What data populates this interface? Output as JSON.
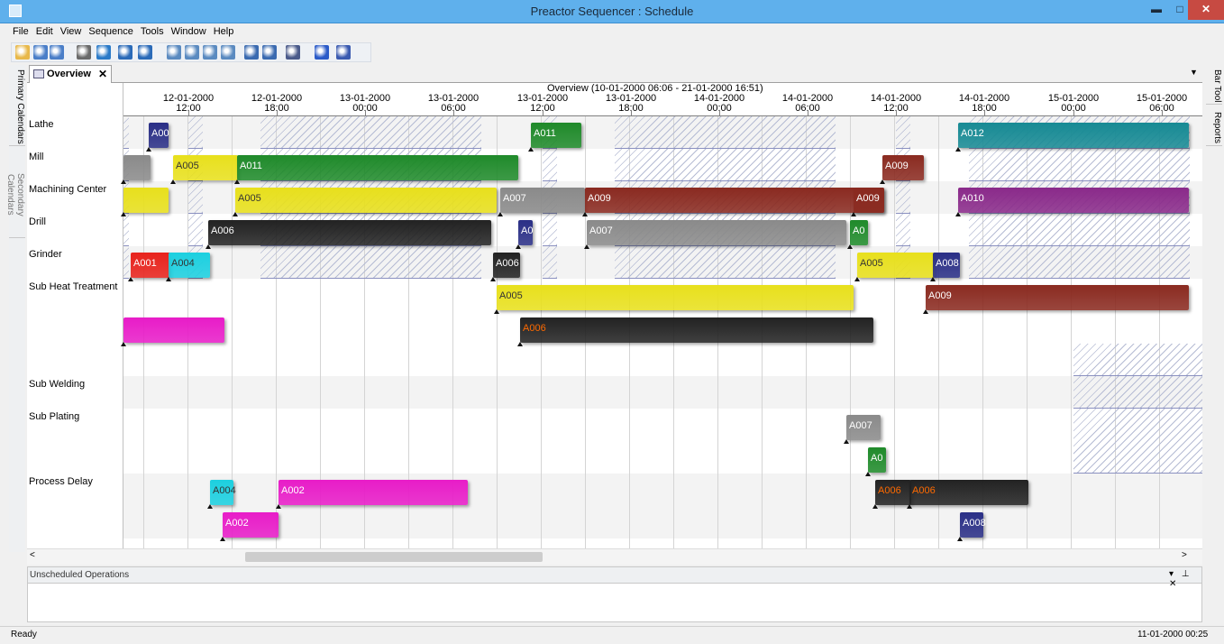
{
  "window": {
    "title": "Preactor Sequencer : Schedule",
    "minimize_glyph": "▬",
    "maximize_glyph": "□",
    "close_glyph": "✕"
  },
  "menu": [
    "File",
    "Edit",
    "View",
    "Sequence",
    "Tools",
    "Window",
    "Help"
  ],
  "toolbar_icons": [
    "open-icon",
    "save-icon",
    "save-all-icon",
    "print-icon",
    "check-icon",
    "undo-icon",
    "redo-icon",
    "view-icon",
    "grid-icon",
    "chart-icon",
    "table-icon",
    "export-icon",
    "import-icon",
    "find-icon",
    "help-icon",
    "document-icon"
  ],
  "side_tabs": {
    "left": [
      "Primary Calendars",
      "Secondary Calendars"
    ],
    "right": [
      "Bar Tool",
      "Reports"
    ]
  },
  "doc_tab": {
    "label": "Overview",
    "close": "✕"
  },
  "gantt": {
    "overview_label": "Overview    (10-01-2000 06:06 - 21-01-2000 16:51)",
    "ticks": [
      {
        "date": "12-01-2000",
        "time": "12:00"
      },
      {
        "date": "12-01-2000",
        "time": "18:00"
      },
      {
        "date": "13-01-2000",
        "time": "00:00"
      },
      {
        "date": "13-01-2000",
        "time": "06:00"
      },
      {
        "date": "13-01-2000",
        "time": "12:00"
      },
      {
        "date": "13-01-2000",
        "time": "18:00"
      },
      {
        "date": "14-01-2000",
        "time": "00:00"
      },
      {
        "date": "14-01-2000",
        "time": "06:00"
      },
      {
        "date": "14-01-2000",
        "time": "12:00"
      },
      {
        "date": "14-01-2000",
        "time": "18:00"
      },
      {
        "date": "15-01-2000",
        "time": "00:00"
      },
      {
        "date": "15-01-2000",
        "time": "06:00"
      }
    ],
    "resources": [
      "Lathe",
      "Mill",
      "Machining Center",
      "Drill",
      "Grinder",
      "Sub Heat Treatment",
      "Sub Welding",
      "Sub Plating",
      "Process Delay"
    ],
    "operations": [
      {
        "resource": "Lathe",
        "label": "A00",
        "color": "#2a2f86",
        "text_color": "#ffffff"
      },
      {
        "resource": "Lathe",
        "label": "A011",
        "color": "#1f8a2a",
        "text_color": "#ffffff"
      },
      {
        "resource": "Lathe",
        "label": "A012",
        "color": "#178a94",
        "text_color": "#ffffff"
      },
      {
        "resource": "Mill",
        "label": "",
        "color": "#8a8a8a",
        "text_color": "#ffffff"
      },
      {
        "resource": "Mill",
        "label": "A005",
        "color": "#e8e01c",
        "text_color": "#333333"
      },
      {
        "resource": "Mill",
        "label": "A011",
        "color": "#1f8a2a",
        "text_color": "#ffffff"
      },
      {
        "resource": "Mill",
        "label": "A009",
        "color": "#8a2a20",
        "text_color": "#ffffff"
      },
      {
        "resource": "Machining Center",
        "label": "",
        "color": "#e8e01c",
        "text_color": "#333333"
      },
      {
        "resource": "Machining Center",
        "label": "A005",
        "color": "#e8e01c",
        "text_color": "#333333"
      },
      {
        "resource": "Machining Center",
        "label": "A007",
        "color": "#8a8a8a",
        "text_color": "#ffffff"
      },
      {
        "resource": "Machining Center",
        "label": "A009",
        "color": "#8a2a20",
        "text_color": "#ffffff"
      },
      {
        "resource": "Machining Center",
        "label": "A009",
        "color": "#8a2a20",
        "text_color": "#ffffff"
      },
      {
        "resource": "Machining Center",
        "label": "A010",
        "color": "#8a2a8a",
        "text_color": "#ffffff"
      },
      {
        "resource": "Drill",
        "label": "A006",
        "color": "#222222",
        "text_color": "#ffffff"
      },
      {
        "resource": "Drill",
        "label": "A0",
        "color": "#2a2f86",
        "text_color": "#ffffff"
      },
      {
        "resource": "Drill",
        "label": "A007",
        "color": "#8a8a8a",
        "text_color": "#ffffff"
      },
      {
        "resource": "Drill",
        "label": "A0",
        "color": "#1f8a2a",
        "text_color": "#ffffff"
      },
      {
        "resource": "Grinder",
        "label": "A001",
        "color": "#e8231c",
        "text_color": "#ffffff"
      },
      {
        "resource": "Grinder",
        "label": "A004",
        "color": "#1cd0e0",
        "text_color": "#333333"
      },
      {
        "resource": "Grinder",
        "label": "A006",
        "color": "#222222",
        "text_color": "#ffffff"
      },
      {
        "resource": "Grinder",
        "label": "A005",
        "color": "#e8e01c",
        "text_color": "#333333"
      },
      {
        "resource": "Grinder",
        "label": "A008",
        "color": "#2a2f86",
        "text_color": "#ffffff"
      },
      {
        "resource": "Sub Heat Treatment",
        "label": "A005",
        "color": "#e8e01c",
        "text_color": "#333333"
      },
      {
        "resource": "Sub Heat Treatment",
        "label": "A009",
        "color": "#8a2a20",
        "text_color": "#ffffff"
      },
      {
        "resource": "Sub Heat Treatment",
        "label": "",
        "color": "#e81cc8",
        "text_color": "#ffffff"
      },
      {
        "resource": "Sub Heat Treatment",
        "label": "A006",
        "color": "#222222",
        "text_color": "#ff6a00"
      },
      {
        "resource": "Sub Plating",
        "label": "A007",
        "color": "#8a8a8a",
        "text_color": "#ffffff"
      },
      {
        "resource": "Sub Plating",
        "label": "A0",
        "color": "#1f8a2a",
        "text_color": "#ffffff"
      },
      {
        "resource": "Process Delay",
        "label": "A004",
        "color": "#1cd0e0",
        "text_color": "#333333"
      },
      {
        "resource": "Process Delay",
        "label": "A002",
        "color": "#e81cc8",
        "text_color": "#ffffff"
      },
      {
        "resource": "Process Delay",
        "label": "A006",
        "color": "#222222",
        "text_color": "#ff6a00"
      },
      {
        "resource": "Process Delay",
        "label": "A006",
        "color": "#222222",
        "text_color": "#ff6a00"
      },
      {
        "resource": "Process Delay",
        "label": "A002",
        "color": "#e81cc8",
        "text_color": "#ffffff"
      },
      {
        "resource": "Process Delay",
        "label": "A008",
        "color": "#2a2f86",
        "text_color": "#ffffff"
      }
    ]
  },
  "scroll": {
    "left_arrow": "<",
    "right_arrow": ">"
  },
  "unscheduled": {
    "title": "Unscheduled Operations",
    "controls": [
      "▾",
      "⊥",
      "✕"
    ]
  },
  "status": {
    "left": "Ready",
    "right": "11-01-2000 00:25"
  }
}
